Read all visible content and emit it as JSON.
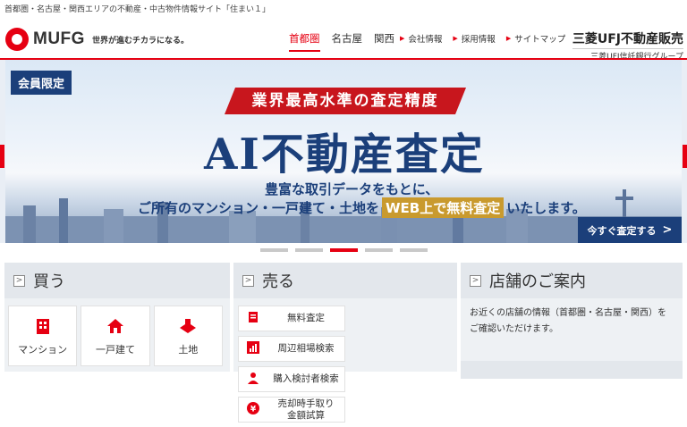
{
  "tagline": "首都圏・名古屋・関西エリアの不動産・中古物件情報サイト「住まい１」",
  "header": {
    "logo_text": "MUFG",
    "slogan": "世界が進むチカラになる。",
    "regions": [
      {
        "label": "首都圏",
        "active": true
      },
      {
        "label": "名古屋",
        "active": false
      },
      {
        "label": "関西",
        "active": false
      }
    ],
    "links": [
      {
        "label": "会社情報"
      },
      {
        "label": "採用情報"
      },
      {
        "label": "サイトマップ"
      }
    ],
    "brand_main": "三菱UFJ不動産販売",
    "brand_sub": "三菱UFJ信託銀行グループ"
  },
  "hero": {
    "badge": "会員限定",
    "ribbon": "業界最高水準の査定精度",
    "title": "AI不動産査定",
    "line1": "豊富な取引データをもとに、",
    "line2_pre": "ご所有のマンション・一戸建て・土地を",
    "line2_highlight_a": "WEB上で",
    "line2_highlight_b": "無料査定",
    "line2_post": "いたします。",
    "cta_label": "今すぐ査定する",
    "slides": 5,
    "active_slide": 3
  },
  "buy": {
    "title": "買う",
    "items": [
      {
        "label": "マンション",
        "icon": "building-icon"
      },
      {
        "label": "一戸建て",
        "icon": "house-icon"
      },
      {
        "label": "土地",
        "icon": "land-icon"
      }
    ]
  },
  "sell": {
    "title": "売る",
    "items": [
      {
        "label": "無料査定",
        "icon": "document-icon"
      },
      {
        "label": "周辺相場検索",
        "icon": "chart-icon"
      },
      {
        "label": "購入検討者検索",
        "icon": "person-icon"
      },
      {
        "label": "売却時手取り金額試算",
        "label_line1": "売却時手取り",
        "label_line2": "金額試算",
        "icon": "yen-icon"
      }
    ]
  },
  "store": {
    "title": "店舗のご案内",
    "description": "お近くの店舗の情報（首都圏・名古屋・関西）をご確認いただけます。"
  },
  "colors": {
    "accent": "#e60012",
    "navy": "#1b3f7a",
    "gold": "#c99a2e"
  }
}
